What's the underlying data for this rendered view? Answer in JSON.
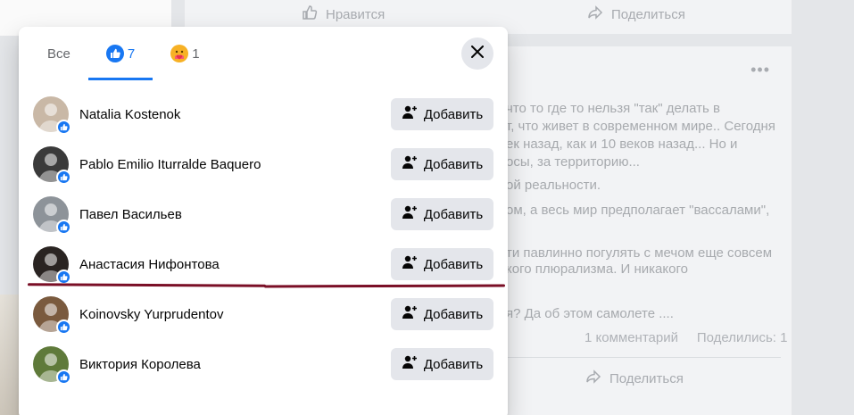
{
  "background": {
    "like_label": "Нравится",
    "share_label": "Поделиться",
    "post_lines": [
      "что то где то нельзя \"так\" делать в",
      "т, что живет в современном мире.. Сегодня",
      "ек назад, как и 10 веков назад... Но и",
      "осы, за территорию...",
      "ой реальности.",
      "ом, а весь мир предполагает \"вассалами\",",
      "",
      "ти павлинно погулять с мечом еще совсем",
      "кого плюрализма.  И никакого",
      "",
      "я? Да об этом самолете ...."
    ],
    "comments": "1 комментарий",
    "shares": "Поделились: 1",
    "share_label_2": "Поделиться"
  },
  "modal": {
    "tabs": [
      {
        "label": "Все",
        "icon": "none",
        "active": false
      },
      {
        "label": "7",
        "icon": "like-reaction-icon",
        "active": true
      },
      {
        "label": "1",
        "icon": "care-reaction-icon",
        "active": false
      }
    ],
    "people": [
      {
        "name": "Natalia Kostenok",
        "button": "Добавить",
        "avatar_color": "#c9b8a6"
      },
      {
        "name": "Pablo Emilio Iturralde Baquero",
        "button": "Добавить",
        "avatar_color": "#3a3a3a"
      },
      {
        "name": "Павел Васильев",
        "button": "Добавить",
        "avatar_color": "#8d9399"
      },
      {
        "name": "Анастасия Нифонтова",
        "button": "Добавить",
        "avatar_color": "#2a2422"
      },
      {
        "name": "Koinovsky Yurprudentov",
        "button": "Добавить",
        "avatar_color": "#7a5a3e"
      },
      {
        "name": "Виктория Королева",
        "button": "Добавить",
        "avatar_color": "#5f7a3a"
      }
    ]
  },
  "annotation_color": "#7a0f26"
}
